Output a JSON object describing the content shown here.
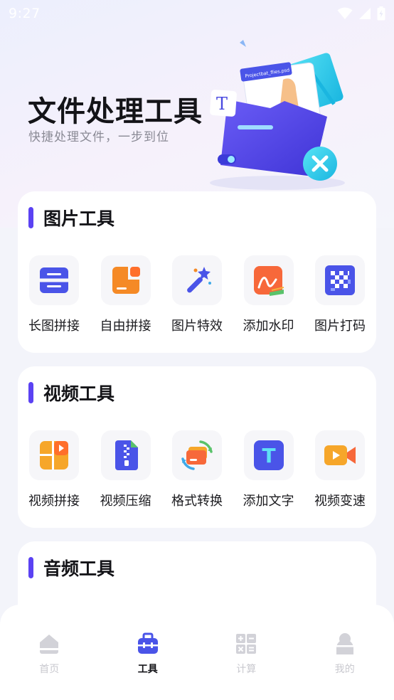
{
  "status_bar": {
    "time": "9:27"
  },
  "hero": {
    "title": "文件处理工具",
    "subtitle": "快捷处理文件，一步到位",
    "file_tag": "Projectbat_flies.psd",
    "t_badge": "T"
  },
  "sections": [
    {
      "title": "图片工具",
      "items": [
        {
          "label": "长图拼接",
          "icon": "long-image-stitch-icon"
        },
        {
          "label": "自由拼接",
          "icon": "free-stitch-icon"
        },
        {
          "label": "图片特效",
          "icon": "magic-wand-icon"
        },
        {
          "label": "添加水印",
          "icon": "watermark-icon"
        },
        {
          "label": "图片打码",
          "icon": "mosaic-icon"
        }
      ]
    },
    {
      "title": "视频工具",
      "items": [
        {
          "label": "视频拼接",
          "icon": "video-stitch-icon"
        },
        {
          "label": "视频压缩",
          "icon": "video-compress-icon"
        },
        {
          "label": "格式转换",
          "icon": "format-convert-icon"
        },
        {
          "label": "添加文字",
          "icon": "add-text-icon",
          "glyph": "T"
        },
        {
          "label": "视频变速",
          "icon": "video-speed-icon"
        }
      ]
    },
    {
      "title": "音频工具",
      "items": []
    }
  ],
  "bottom_nav": {
    "items": [
      {
        "label": "首页",
        "icon": "home-icon",
        "active": false
      },
      {
        "label": "工具",
        "icon": "toolbox-icon",
        "active": true
      },
      {
        "label": "计算",
        "icon": "calculator-icon",
        "active": false
      },
      {
        "label": "我的",
        "icon": "profile-icon",
        "active": false
      }
    ]
  },
  "colors": {
    "accent": "#5b42f3",
    "orange": "#f58a26",
    "blue": "#4a54e8",
    "inactive_nav": "#c9c9cf"
  }
}
